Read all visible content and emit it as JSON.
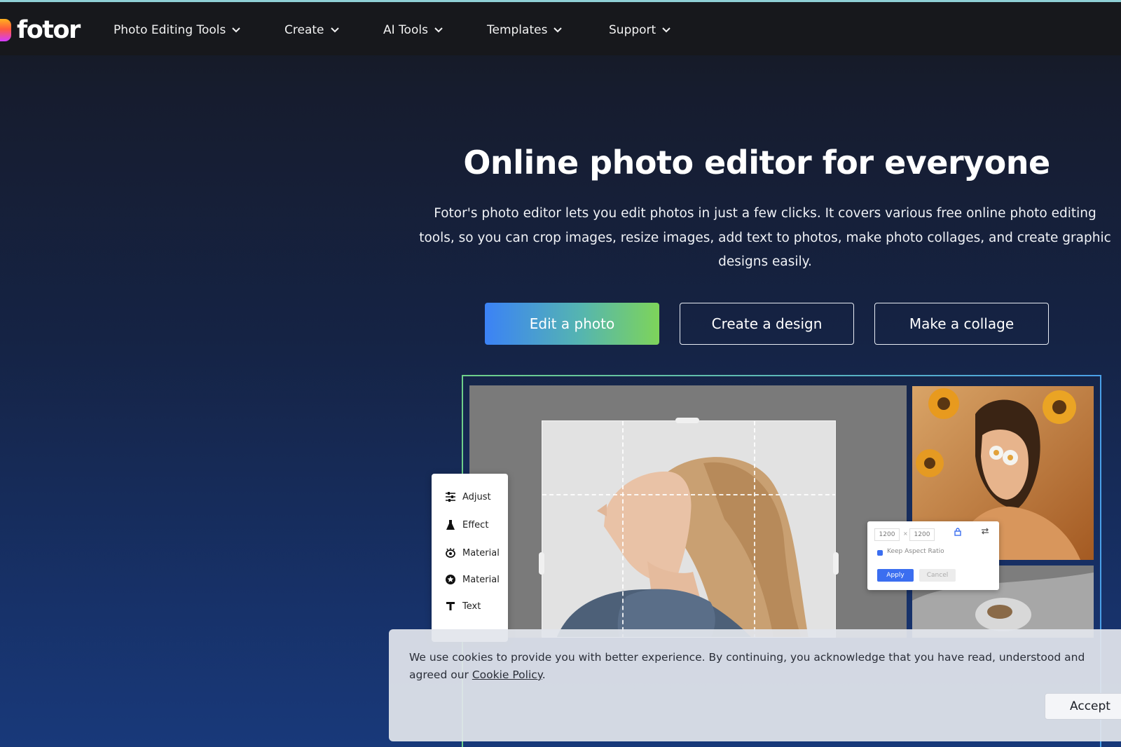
{
  "brand": {
    "name": "fotor"
  },
  "nav": {
    "items": [
      {
        "label": "Photo Editing Tools"
      },
      {
        "label": "Create"
      },
      {
        "label": "AI Tools"
      },
      {
        "label": "Templates"
      },
      {
        "label": "Support"
      }
    ]
  },
  "hero": {
    "title": "Online photo editor for everyone",
    "description": "Fotor's photo editor lets you edit photos in just a few clicks. It covers various free online photo editing tools, so you can crop images, resize images, add text to photos, make photo collages, and create graphic designs easily.",
    "buttons": {
      "edit": "Edit a photo",
      "design": "Create a design",
      "collage": "Make a collage"
    }
  },
  "editor_preview": {
    "tools": [
      {
        "label": "Adjust",
        "icon": "sliders-icon"
      },
      {
        "label": "Effect",
        "icon": "flask-icon"
      },
      {
        "label": "Material",
        "icon": "eye-icon"
      },
      {
        "label": "Material",
        "icon": "star-badge-icon"
      },
      {
        "label": "Text",
        "icon": "text-icon"
      }
    ],
    "resize": {
      "width": "1200",
      "times": "×",
      "height": "1200",
      "keep_ratio": "Keep Aspect Ratio",
      "apply": "Apply",
      "cancel": "Cancel"
    }
  },
  "cookie": {
    "text": "We use cookies to provide you with better experience. By continuing, you acknowledge that you have read, understood and agreed our ",
    "link": "Cookie Policy",
    "end": ".",
    "accept": "Accept"
  },
  "colors": {
    "primary_gradient_start": "#3b82f6",
    "primary_gradient_end": "#7ed45a",
    "nav_bg": "#17181c",
    "accent_blue": "#3b6ef0"
  }
}
